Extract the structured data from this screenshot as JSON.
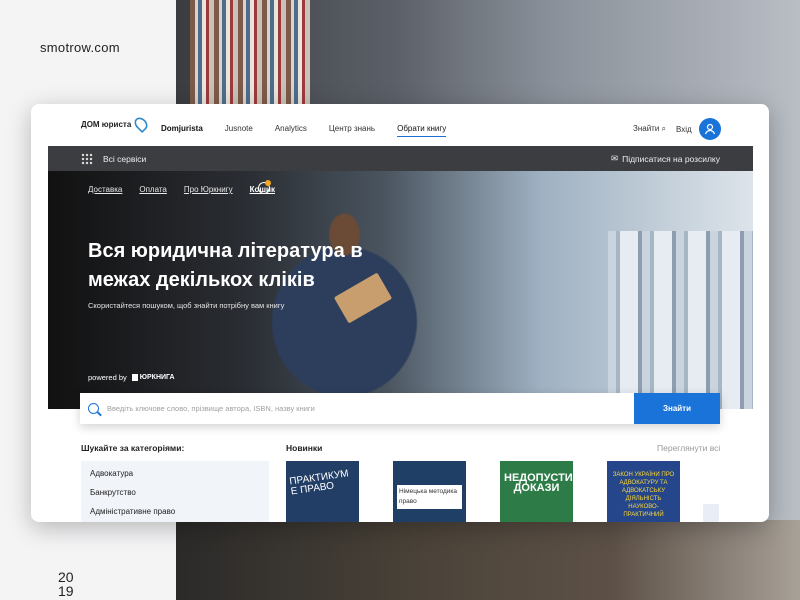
{
  "watermark": {
    "site": "smotrow.com",
    "year_top": "20",
    "year_bottom": "19"
  },
  "header": {
    "logo_text": "ДОМ юриста",
    "menu": [
      {
        "label": "Domjurista"
      },
      {
        "label": "Jusnote"
      },
      {
        "label": "Analytics"
      },
      {
        "label": "Центр знань"
      },
      {
        "label": "Обрати книгу"
      }
    ],
    "find": "Знайти",
    "login": "Вхід"
  },
  "servicebar": {
    "services": "Всі сервіси",
    "subscribe": "Підписатися на розсилку"
  },
  "hero": {
    "links": [
      "Доставка",
      "Оплата",
      "Про Юркнигу",
      "Кошик"
    ],
    "title": "Вся юридична література в межах декількох кліків",
    "subtitle": "Скористайтеся пошуком, щоб знайти потрібну вам книгу",
    "powered_by": "powered by",
    "powered_brand": "ЮРКНИГА"
  },
  "search": {
    "placeholder": "Введіть ключове слово, прізвище автора, ISBN, назву книги",
    "button": "Знайти"
  },
  "categories": {
    "title": "Шукайте за категоріями:",
    "items": [
      "Адвокатура",
      "Банкрутство",
      "Адміністративне право"
    ]
  },
  "new_books": {
    "title": "Новинки",
    "see_all": "Переглянути всі",
    "books": [
      {
        "label": "ПРАКТИКУМ Е ПРАВО"
      },
      {
        "label": "Німецька методика право"
      },
      {
        "label": "НЕДОПУСТИМІ ДОКАЗИ"
      },
      {
        "label": "ЗАКОН УКРАЇНИ ПРО АДВОКАТУРУ ТА АДВОКАТСЬКУ ДІЯЛЬНІСТЬ НАУКОВО-ПРАКТИЧНИЙ"
      }
    ]
  },
  "colors": {
    "accent": "#1a73d9",
    "bar": "#3c3d40"
  }
}
